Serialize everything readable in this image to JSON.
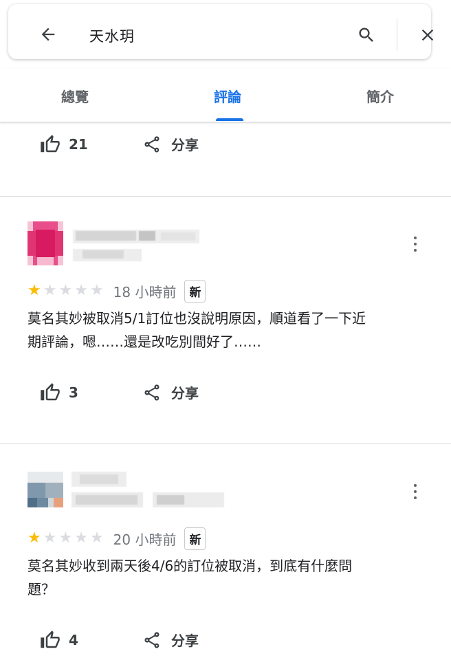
{
  "search": {
    "query": "天水玥",
    "back_icon": "arrow-left-icon",
    "search_icon": "search-icon",
    "close_icon": "close-icon"
  },
  "tabs": [
    {
      "label": "總覽",
      "active": false
    },
    {
      "label": "評論",
      "active": true
    },
    {
      "label": "簡介",
      "active": false
    }
  ],
  "colors": {
    "accent": "#1a73e8",
    "star_on": "#fbbc04",
    "star_off": "#dadce0",
    "avatar1": "#d81b60",
    "avatar2": "#78909c"
  },
  "top_actions": {
    "likes": "21",
    "share_label": "分享"
  },
  "reviews": [
    {
      "rating": 1,
      "max_rating": 5,
      "time": "18 小時前",
      "badge": "新",
      "text_line1": "莫名其妙被取消5/1訂位也沒說明原因，順道看了一下近",
      "text_line2": "期評論，嗯……還是改吃別間好了……",
      "likes": "3",
      "share_label": "分享"
    },
    {
      "rating": 1,
      "max_rating": 5,
      "time": "20 小時前",
      "badge": "新",
      "text_line1": "莫名其妙收到兩天後4/6的訂位被取消，到底有什麼問",
      "text_line2": "題？",
      "likes": "4",
      "share_label": "分享"
    }
  ]
}
